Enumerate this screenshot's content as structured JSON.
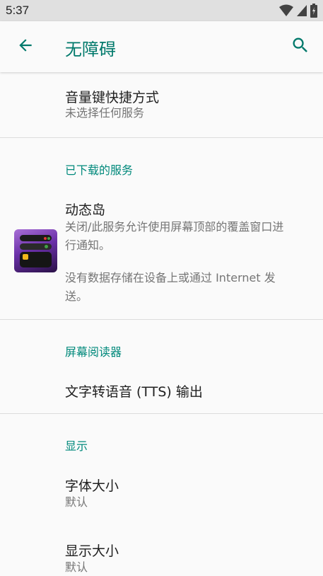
{
  "status_bar": {
    "time": "5:37"
  },
  "app_bar": {
    "title": "无障碍",
    "back_icon": "arrow-back-icon",
    "search_icon": "search-icon"
  },
  "items": {
    "volume_shortcut": {
      "title": "音量键快捷方式",
      "summary": "未选择任何服务"
    },
    "downloaded_header": "已下载的服务",
    "dynamic_island": {
      "title": "动态岛",
      "summary_line1": "关闭/此服务允许使用屏幕顶部的覆盖窗口进",
      "summary_line2": "行通知。",
      "note_line1": "没有数据存储在设备上或通过 Internet 发",
      "note_line2": "送。"
    },
    "screen_reader_header": "屏幕阅读器",
    "tts": {
      "title": "文字转语音 (TTS) 输出"
    },
    "display_header": "显示",
    "font_size": {
      "title": "字体大小",
      "summary": "默认"
    },
    "display_size": {
      "title": "显示大小",
      "summary": "默认"
    }
  },
  "colors": {
    "accent": "#00796b",
    "status_bar": "#e0e0e0",
    "background": "#fafafa"
  }
}
